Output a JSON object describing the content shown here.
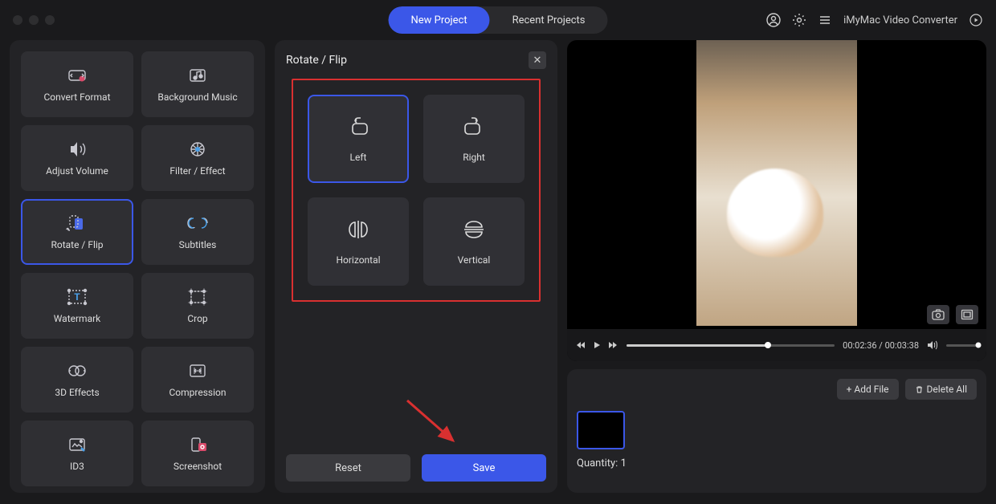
{
  "tabs": {
    "new": "New Project",
    "recent": "Recent Projects"
  },
  "appTitle": "iMyMac Video Converter",
  "tools": [
    {
      "label": "Convert Format",
      "icon": "convert"
    },
    {
      "label": "Background Music",
      "icon": "bgmusic"
    },
    {
      "label": "Adjust Volume",
      "icon": "volume"
    },
    {
      "label": "Filter / Effect",
      "icon": "filter"
    },
    {
      "label": "Rotate / Flip",
      "icon": "rotate",
      "selected": true
    },
    {
      "label": "Subtitles",
      "icon": "subtitles"
    },
    {
      "label": "Watermark",
      "icon": "watermark"
    },
    {
      "label": "Crop",
      "icon": "crop"
    },
    {
      "label": "3D Effects",
      "icon": "3d"
    },
    {
      "label": "Compression",
      "icon": "compress"
    },
    {
      "label": "ID3",
      "icon": "id3"
    },
    {
      "label": "Screenshot",
      "icon": "screenshot"
    }
  ],
  "panel": {
    "title": "Rotate / Flip",
    "options": [
      {
        "label": "Left",
        "icon": "rotate-left",
        "selected": true
      },
      {
        "label": "Right",
        "icon": "rotate-right"
      },
      {
        "label": "Horizontal",
        "icon": "flip-h"
      },
      {
        "label": "Vertical",
        "icon": "flip-v"
      }
    ],
    "reset": "Reset",
    "save": "Save"
  },
  "player": {
    "current": "00:02:36",
    "total": "00:03:38",
    "progress": 68
  },
  "queue": {
    "add": "+ Add File",
    "delAll": "Delete All",
    "quantityLabel": "Quantity:",
    "quantity": 1
  }
}
